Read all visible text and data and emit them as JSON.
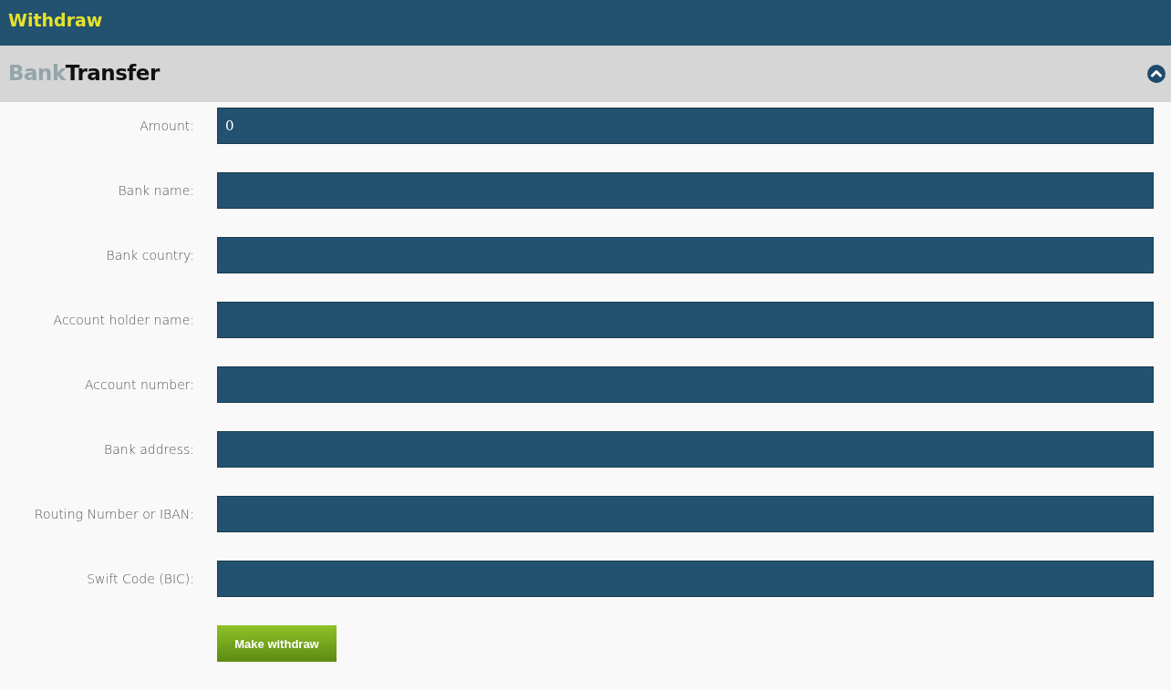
{
  "header": {
    "title": "Withdraw"
  },
  "section": {
    "title_prefix": "Bank",
    "title_main": "Transfer",
    "expanded": true
  },
  "fields": [
    {
      "label": "Amount:",
      "value": "0"
    },
    {
      "label": "Bank name:"
    },
    {
      "label": "Bank country:"
    },
    {
      "label": "Account holder name:"
    },
    {
      "label": "Account number:"
    },
    {
      "label": "Bank address:"
    },
    {
      "label": "Routing Number or IBAN:"
    },
    {
      "label": "Swift Code (BIC):"
    }
  ],
  "submit": {
    "label": "Make withdraw"
  }
}
